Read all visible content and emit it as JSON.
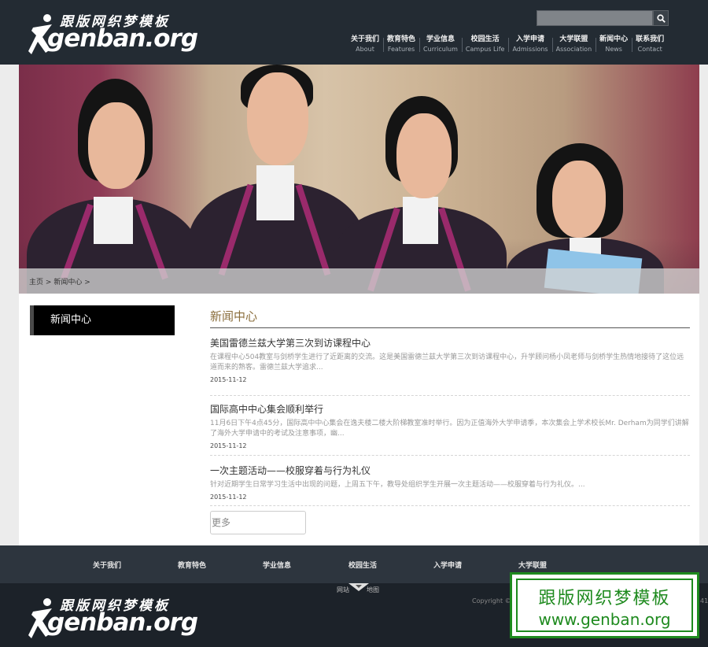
{
  "brand": {
    "logo_cn": "跟版网织梦模板",
    "logo_en": "genban.org"
  },
  "search": {
    "value": "",
    "placeholder": ""
  },
  "nav": [
    {
      "zh": "关于我们",
      "en": "About"
    },
    {
      "zh": "教育特色",
      "en": "Features"
    },
    {
      "zh": "学业信息",
      "en": "Curriculum"
    },
    {
      "zh": "校园生活",
      "en": "Campus Life"
    },
    {
      "zh": "入学申请",
      "en": "Admissions"
    },
    {
      "zh": "大学联盟",
      "en": "Association"
    },
    {
      "zh": "新闻中心",
      "en": "News"
    },
    {
      "zh": "联系我们",
      "en": "Contact"
    }
  ],
  "breadcrumb": {
    "home": "主页",
    "sep1": ">",
    "current": "新闻中心",
    "sep2": ">"
  },
  "sidebar": {
    "title": "新闻中心"
  },
  "content": {
    "title": "新闻中心",
    "more_label": "更多",
    "articles": [
      {
        "title": "美国雷德兰兹大学第三次到访课程中心",
        "summary": "在课程中心504教室与剑桥学生进行了近距离的交流。这是美国雷德兰兹大学第三次到访课程中心，升学顾问杨小凤老师与剑桥学生热情地接待了这位远道而来的熟客。雷德兰兹大学追求...",
        "date": "2015-11-12"
      },
      {
        "title": "国际高中中心集会顺利举行",
        "summary": "11月6日下午4点45分，国际高中中心集会在逸夫楼二楼大阶梯教室准时举行。因为正值海外大学申请季，本次集会上学术校长Mr. Derham为同学们讲解了海外大学申请中的考试及注意事项，幽...",
        "date": "2015-11-12"
      },
      {
        "title": "一次主题活动——校服穿着与行为礼仪",
        "summary": "针对近期学生日常学习生活中出现的问题，上周五下午，教导处组织学生开展一次主题活动——校服穿着与行为礼仪。...",
        "date": "2015-11-12"
      }
    ]
  },
  "footer_nav": [
    "关于我们",
    "教育特色",
    "学业信息",
    "校园生活",
    "入学申请",
    "大学联盟"
  ],
  "footer": {
    "sitemap_1": "网站",
    "sitemap_2": "地图",
    "copyright": "Copyright ©",
    "tail": "41"
  },
  "watermark": {
    "cn": "跟版网织梦模板",
    "en": "www.genban.org"
  },
  "colors": {
    "header_bg": "#232b33",
    "accent_title": "#8a6d3b",
    "watermark_green": "#1e8a1e"
  }
}
